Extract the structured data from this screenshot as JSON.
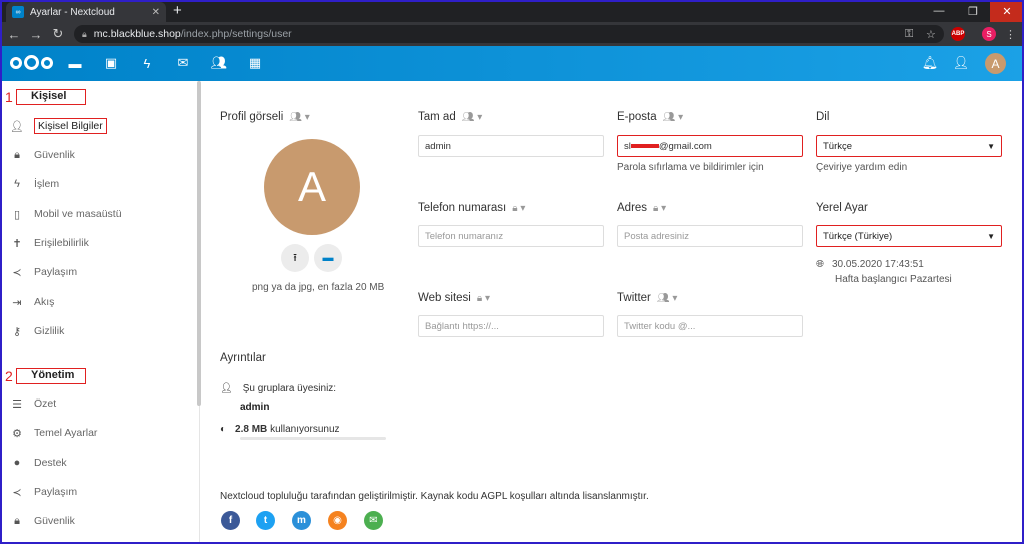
{
  "browser": {
    "tab_title": "Ayarlar - Nextcloud",
    "url_host": "mc.blackblue.shop",
    "url_path": "/index.php/settings/user",
    "profile_initial": "S",
    "abp_label": "ABP"
  },
  "header": {
    "avatar_initial": "A",
    "apps": [
      "files-icon",
      "photos-icon",
      "activity-icon",
      "mail-icon",
      "contacts-icon",
      "calendar-icon"
    ]
  },
  "sidebar": {
    "personal": {
      "number": "1",
      "title": "Kişisel"
    },
    "personal_items": [
      {
        "label": "Kişisel Bilgiler",
        "icon": "user-icon"
      },
      {
        "label": "Güvenlik",
        "icon": "lock-icon"
      },
      {
        "label": "İşlem",
        "icon": "activity-icon"
      },
      {
        "label": "Mobil ve masaüstü",
        "icon": "phone-icon"
      },
      {
        "label": "Erişilebilirlik",
        "icon": "accessibility-icon"
      },
      {
        "label": "Paylaşım",
        "icon": "share-icon"
      },
      {
        "label": "Akış",
        "icon": "flow-icon"
      },
      {
        "label": "Gizlilik",
        "icon": "key-icon"
      }
    ],
    "admin": {
      "number": "2",
      "title": "Yönetim"
    },
    "admin_items": [
      {
        "label": "Özet",
        "icon": "list-icon"
      },
      {
        "label": "Temel Ayarlar",
        "icon": "gear-icon"
      },
      {
        "label": "Destek",
        "icon": "chat-icon"
      },
      {
        "label": "Paylaşım",
        "icon": "share-icon"
      },
      {
        "label": "Güvenlik",
        "icon": "lock-icon"
      }
    ]
  },
  "profile": {
    "picture_label": "Profil görseli",
    "avatar_initial": "A",
    "picture_hint": "png ya da jpg, en fazla 20 MB"
  },
  "fields": {
    "fullname": {
      "label": "Tam ad",
      "value": "admin"
    },
    "email": {
      "label": "E-posta",
      "value_prefix": "sl",
      "value_suffix": "@gmail.com",
      "hint": "Parola sıfırlama ve bildirimler için"
    },
    "language": {
      "label": "Dil",
      "value": "Türkçe",
      "hint": "Çeviriye yardım edin"
    },
    "phone": {
      "label": "Telefon numarası",
      "placeholder": "Telefon numaranız"
    },
    "address": {
      "label": "Adres",
      "placeholder": "Posta adresiniz"
    },
    "locale": {
      "label": "Yerel Ayar",
      "value": "Türkçe (Türkiye)",
      "datetime": "30.05.2020 17:43:51",
      "week_start": "Hafta başlangıcı Pazartesi"
    },
    "website": {
      "label": "Web sitesi",
      "placeholder": "Bağlantı https://..."
    },
    "twitter": {
      "label": "Twitter",
      "placeholder": "Twitter kodu @..."
    }
  },
  "details": {
    "title": "Ayrıntılar",
    "groups_label": "Şu gruplara üyesiniz:",
    "groups_value": "admin",
    "usage_value": "2.8 MB",
    "usage_label": "kullanıyorsunuz"
  },
  "footer": {
    "text": "Nextcloud topluluğu tarafından geliştirilmiştir.  Kaynak kodu AGPL koşulları altında lisanslanmıştır.",
    "social": [
      {
        "name": "facebook",
        "glyph": "f",
        "color": "#3b5998"
      },
      {
        "name": "twitter",
        "glyph": "t",
        "color": "#1da1f2"
      },
      {
        "name": "mastodon",
        "glyph": "m",
        "color": "#2b90d9"
      },
      {
        "name": "rss",
        "glyph": "◉",
        "color": "#f5821f"
      },
      {
        "name": "mail",
        "glyph": "✉",
        "color": "#4caf50"
      }
    ]
  }
}
